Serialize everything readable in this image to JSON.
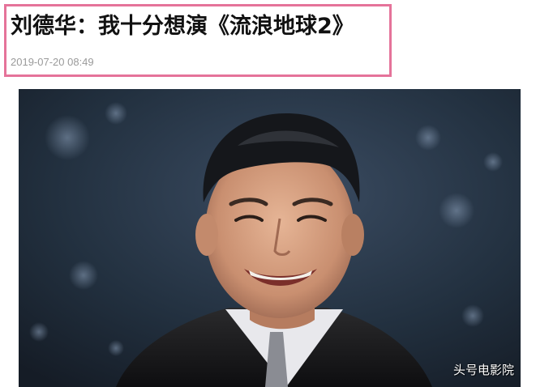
{
  "article": {
    "headline": "刘德华：我十分想演《流浪地球2》",
    "timestamp": "2019-07-20 08:49"
  },
  "photo": {
    "watermark": "头号电影院"
  },
  "colors": {
    "highlight_border": "#e5739a",
    "headline": "#111111",
    "timestamp": "#9a9a9a",
    "photo_background": "#1d2736"
  }
}
